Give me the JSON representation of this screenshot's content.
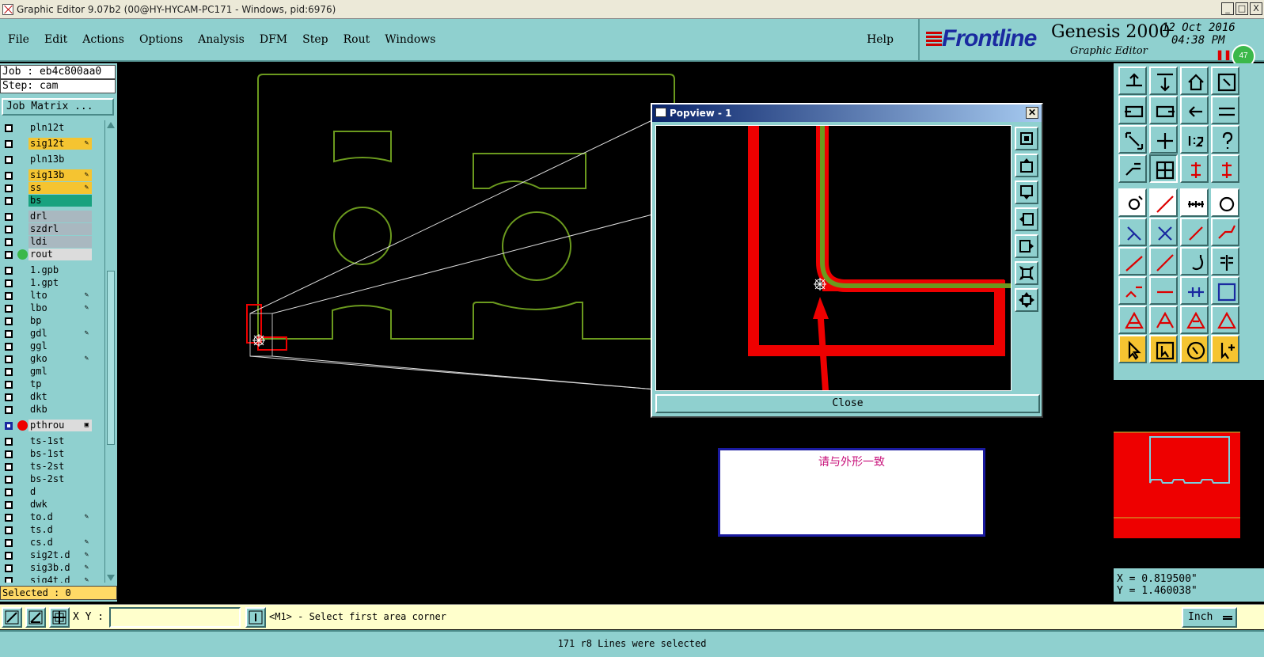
{
  "window": {
    "title": "Graphic Editor 9.07b2 (00@HY-HYCAM-PC171 - Windows, pid:6976)",
    "buttons": [
      "_",
      "□",
      "X"
    ]
  },
  "menu": {
    "items": [
      "File",
      "Edit",
      "Actions",
      "Options",
      "Analysis",
      "DFM",
      "Step",
      "Rout",
      "Windows"
    ],
    "help": "Help"
  },
  "brand": {
    "logo": "Frontline",
    "product": "Genesis 2000",
    "subtitle": "Graphic Editor",
    "date": "12 Oct 2016",
    "time": "04:38 PM",
    "badge": "47"
  },
  "job": {
    "job_line": "Job : eb4c800aa0",
    "step_line": "Step: cam",
    "matrix_button": "Job Matrix ..."
  },
  "layers": [
    {
      "name": "pln12t",
      "color": "#8fd0cf",
      "pin": ""
    },
    {
      "name": "sig12t",
      "color": "#f5c431",
      "pin": "✎"
    },
    {
      "name": "pln13b",
      "color": "#8fd0cf",
      "pin": ""
    },
    {
      "name": "sig13b",
      "color": "#f5c431",
      "pin": "✎"
    },
    {
      "name": "ss",
      "color": "#f5c431",
      "pin": "✎"
    },
    {
      "name": "bs",
      "color": "#19a27f",
      "pin": ""
    },
    {
      "name": "drl",
      "color": "#a9b8c0",
      "pin": ""
    },
    {
      "name": "szdrl",
      "color": "#a9b8c0",
      "pin": ""
    },
    {
      "name": "ldi",
      "color": "#a9b8c0",
      "pin": ""
    },
    {
      "name": "rout",
      "color": "#dcdcdc",
      "pin": ""
    },
    {
      "name": "1.gpb",
      "color": "#8fd0cf",
      "pin": ""
    },
    {
      "name": "1.gpt",
      "color": "#8fd0cf",
      "pin": ""
    },
    {
      "name": "lto",
      "color": "#8fd0cf",
      "pin": "✎"
    },
    {
      "name": "lbo",
      "color": "#8fd0cf",
      "pin": "✎"
    },
    {
      "name": "bp",
      "color": "#8fd0cf",
      "pin": ""
    },
    {
      "name": "gdl",
      "color": "#8fd0cf",
      "pin": "✎"
    },
    {
      "name": "ggl",
      "color": "#8fd0cf",
      "pin": ""
    },
    {
      "name": "gko",
      "color": "#8fd0cf",
      "pin": "✎"
    },
    {
      "name": "gml",
      "color": "#8fd0cf",
      "pin": ""
    },
    {
      "name": "tp",
      "color": "#8fd0cf",
      "pin": ""
    },
    {
      "name": "dkt",
      "color": "#8fd0cf",
      "pin": ""
    },
    {
      "name": "dkb",
      "color": "#8fd0cf",
      "pin": ""
    },
    {
      "name": "pthrou",
      "color": "#dcdcdc",
      "pin": "▣"
    },
    {
      "name": "ts-1st",
      "color": "#8fd0cf",
      "pin": ""
    },
    {
      "name": "bs-1st",
      "color": "#8fd0cf",
      "pin": ""
    },
    {
      "name": "ts-2st",
      "color": "#8fd0cf",
      "pin": ""
    },
    {
      "name": "bs-2st",
      "color": "#8fd0cf",
      "pin": ""
    },
    {
      "name": "d",
      "color": "#8fd0cf",
      "pin": ""
    },
    {
      "name": "dwk",
      "color": "#8fd0cf",
      "pin": ""
    },
    {
      "name": "to.d",
      "color": "#8fd0cf",
      "pin": "✎"
    },
    {
      "name": "ts.d",
      "color": "#8fd0cf",
      "pin": ""
    },
    {
      "name": "cs.d",
      "color": "#8fd0cf",
      "pin": "✎"
    },
    {
      "name": "sig2t.d",
      "color": "#8fd0cf",
      "pin": "✎"
    },
    {
      "name": "sig3b.d",
      "color": "#8fd0cf",
      "pin": "✎"
    },
    {
      "name": "sig4t.d",
      "color": "#8fd0cf",
      "pin": "✎"
    }
  ],
  "selected": "Selected : 0",
  "popview": {
    "title": "Popview - 1",
    "close_x": "✕",
    "close_button": "Close"
  },
  "note": {
    "text": "请与外形一致"
  },
  "coords": {
    "x": "X = 0.819500\"",
    "y": "Y = 1.460038\""
  },
  "command": {
    "xy_label": "X Y :",
    "input_value": "",
    "prompt": "<M1> - Select first area corner",
    "unit": "Inch"
  },
  "status": "171 r8 Lines were selected"
}
